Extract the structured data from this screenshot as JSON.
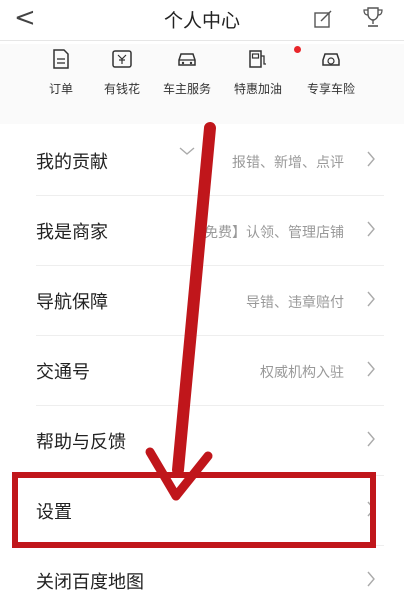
{
  "header": {
    "back_glyph": "<",
    "title": "个人中心"
  },
  "services": [
    {
      "label": "订单",
      "icon": "order-icon"
    },
    {
      "label": "有钱花",
      "icon": "wallet-icon"
    },
    {
      "label": "车主服务",
      "icon": "car-icon"
    },
    {
      "label": "特惠加油",
      "icon": "fuel-icon"
    },
    {
      "label": "专享车险",
      "icon": "car-insurance-icon"
    }
  ],
  "menu": [
    {
      "label": "我的贡献",
      "desc": "报错、新增、点评"
    },
    {
      "label": "我是商家",
      "desc": "【免费】认领、管理店铺"
    },
    {
      "label": "导航保障",
      "desc": "导错、违章赔付"
    },
    {
      "label": "交通号",
      "desc": "权威机构入驻"
    },
    {
      "label": "帮助与反馈",
      "desc": ""
    },
    {
      "label": "设置",
      "desc": ""
    },
    {
      "label": "关闭百度地图",
      "desc": ""
    }
  ],
  "colors": {
    "annotation": "#c0161b",
    "badge": "#e8262a"
  }
}
